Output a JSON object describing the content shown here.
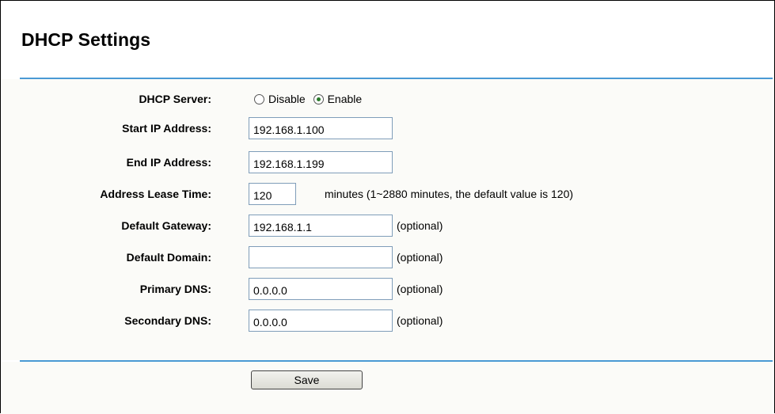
{
  "page": {
    "title": "DHCP Settings"
  },
  "dhcp_server": {
    "label": "DHCP Server:",
    "options": [
      "Disable",
      "Enable"
    ],
    "selected": "Enable"
  },
  "start_ip": {
    "label": "Start IP Address:",
    "value": "192.168.1.100"
  },
  "end_ip": {
    "label": "End IP Address:",
    "value": "192.168.1.199"
  },
  "lease_time": {
    "label": "Address Lease Time:",
    "value": "120",
    "hint": "minutes (1~2880 minutes, the default value is 120)"
  },
  "default_gateway": {
    "label": "Default Gateway:",
    "value": "192.168.1.1",
    "hint": "(optional)"
  },
  "default_domain": {
    "label": "Default Domain:",
    "value": "",
    "hint": "(optional)"
  },
  "primary_dns": {
    "label": "Primary DNS:",
    "value": "0.0.0.0",
    "hint": "(optional)"
  },
  "secondary_dns": {
    "label": "Secondary DNS:",
    "value": "0.0.0.0",
    "hint": "(optional)"
  },
  "actions": {
    "save_label": "Save"
  },
  "colors": {
    "rule": "#4a9ad4",
    "panel_background": "#fbfbf8",
    "radio_selected": "#2a7a2a"
  }
}
